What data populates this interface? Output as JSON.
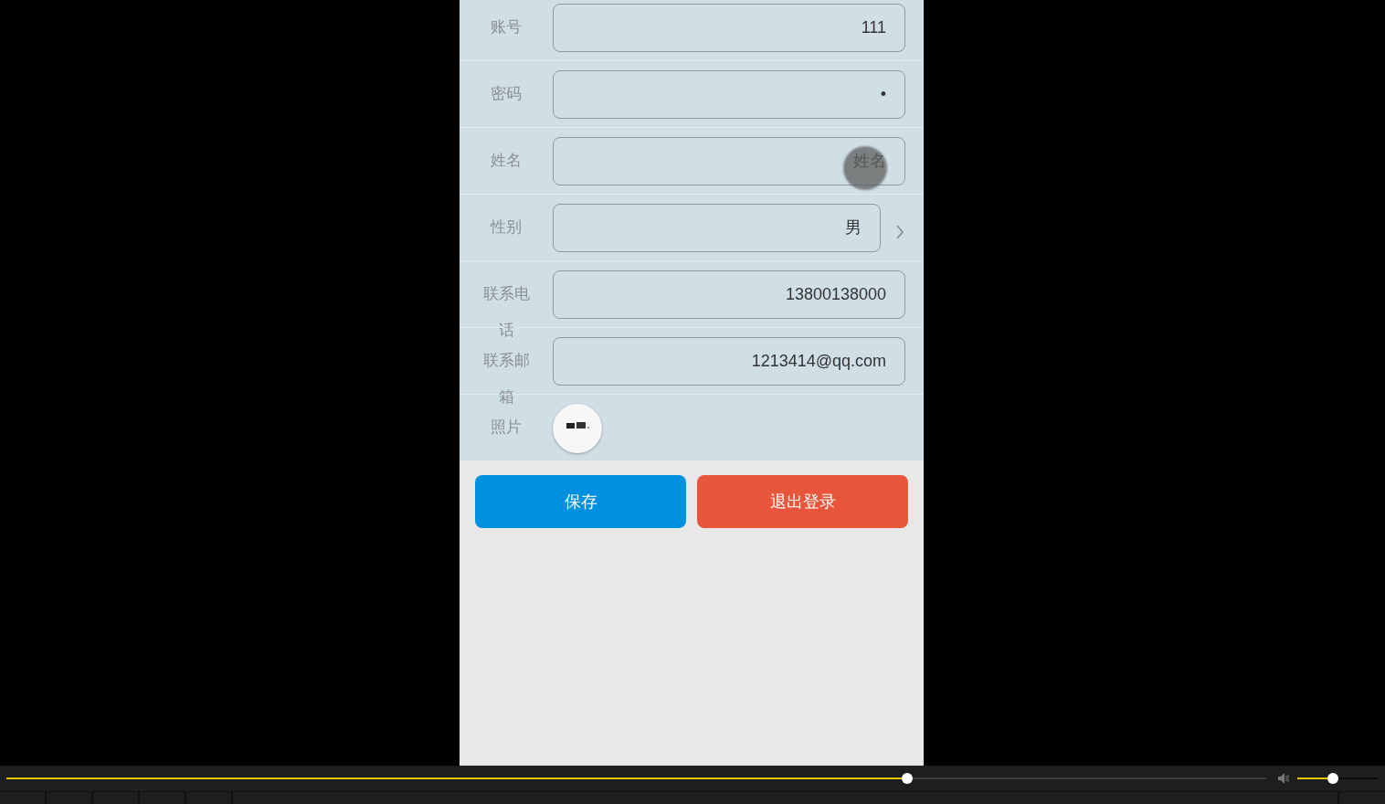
{
  "form": {
    "rows": [
      {
        "kind": "input",
        "label": "账号",
        "value": "111"
      },
      {
        "kind": "input",
        "label": "密码",
        "value": "•"
      },
      {
        "kind": "input",
        "label": "姓名",
        "placeholder": "姓名",
        "touched": true
      },
      {
        "kind": "select",
        "label": "性别",
        "value": "男"
      },
      {
        "kind": "input",
        "label": "联系电话",
        "value": "13800138000"
      },
      {
        "kind": "input",
        "label": "联系邮箱",
        "value": "1213414@qq.com"
      },
      {
        "label": "照片"
      }
    ]
  },
  "buttons": [
    {
      "label": "保存",
      "color": "#0090e0"
    },
    {
      "label": "退出登录",
      "color": "#e9553a"
    }
  ],
  "player": {
    "seek": {
      "level": 0.715
    },
    "volume": {
      "level": 0.44
    }
  }
}
